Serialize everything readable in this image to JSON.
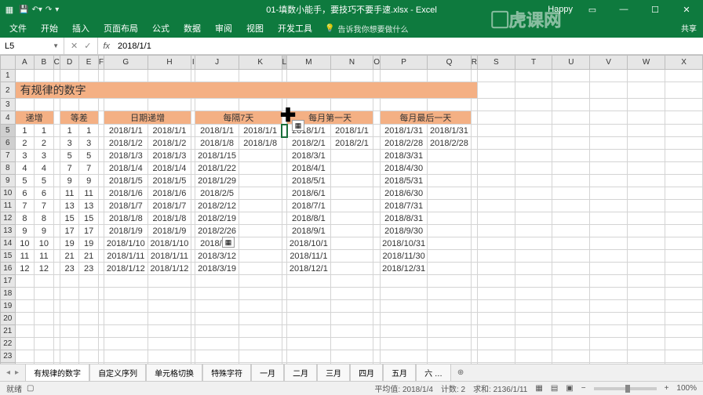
{
  "title": "01-填数小能手，要技巧不要手速.xlsx - Excel",
  "user": "Happy",
  "qat": [
    "save",
    "undo",
    "redo"
  ],
  "ribbon": [
    "文件",
    "开始",
    "插入",
    "页面布局",
    "公式",
    "数据",
    "审阅",
    "视图",
    "开发工具"
  ],
  "tell_me": "告诉我你想要做什么",
  "name_box": "L5",
  "formula": "2018/1/1",
  "columns": [
    "A",
    "B",
    "C",
    "D",
    "E",
    "F",
    "G",
    "H",
    "I",
    "J",
    "K",
    "L",
    "M",
    "N",
    "O",
    "P",
    "Q",
    "R",
    "S",
    "T",
    "U",
    "V",
    "W",
    "X"
  ],
  "big_title": "有规律的数字",
  "section_headers": {
    "incr": "递增",
    "diff": "等差",
    "date_incr": "日期递增",
    "every7": "每隔7天",
    "month_first": "每月第一天",
    "month_last": "每月最后一天"
  },
  "col_widths": [
    "xs",
    "s",
    "s",
    "gap",
    "s",
    "s",
    "gap",
    "m",
    "m",
    "gap",
    "m",
    "m",
    "gap",
    "m",
    "m",
    "gap",
    "m",
    "m",
    "gap",
    "m",
    "m",
    "m",
    "m",
    "m",
    "m"
  ],
  "data_rows": [
    [
      1,
      1,
      1,
      1,
      "2018/1/1",
      "2018/1/1",
      "2018/1/1",
      "2018/1/1",
      "2018/1/1",
      "2018/1/1",
      "2018/1/31",
      "2018/1/31"
    ],
    [
      2,
      2,
      3,
      3,
      "2018/1/2",
      "2018/1/2",
      "2018/1/8",
      "2018/1/8",
      "2018/2/1",
      "2018/2/1",
      "2018/2/28",
      "2018/2/28"
    ],
    [
      3,
      3,
      5,
      5,
      "2018/1/3",
      "2018/1/3",
      "2018/1/15",
      "",
      "2018/3/1",
      "",
      "2018/3/31",
      ""
    ],
    [
      4,
      4,
      7,
      7,
      "2018/1/4",
      "2018/1/4",
      "2018/1/22",
      "",
      "2018/4/1",
      "",
      "2018/4/30",
      ""
    ],
    [
      5,
      5,
      9,
      9,
      "2018/1/5",
      "2018/1/5",
      "2018/1/29",
      "",
      "2018/5/1",
      "",
      "2018/5/31",
      ""
    ],
    [
      6,
      6,
      11,
      11,
      "2018/1/6",
      "2018/1/6",
      "2018/2/5",
      "",
      "2018/6/1",
      "",
      "2018/6/30",
      ""
    ],
    [
      7,
      7,
      13,
      13,
      "2018/1/7",
      "2018/1/7",
      "2018/2/12",
      "",
      "2018/7/1",
      "",
      "2018/7/31",
      ""
    ],
    [
      8,
      8,
      15,
      15,
      "2018/1/8",
      "2018/1/8",
      "2018/2/19",
      "",
      "2018/8/1",
      "",
      "2018/8/31",
      ""
    ],
    [
      9,
      9,
      17,
      17,
      "2018/1/9",
      "2018/1/9",
      "2018/2/26",
      "",
      "2018/9/1",
      "",
      "2018/9/30",
      ""
    ],
    [
      10,
      10,
      19,
      19,
      "2018/1/10",
      "2018/1/10",
      "2018/3/5",
      "",
      "2018/10/1",
      "",
      "2018/10/31",
      ""
    ],
    [
      11,
      11,
      21,
      21,
      "2018/1/11",
      "2018/1/11",
      "2018/3/12",
      "",
      "2018/11/1",
      "",
      "2018/11/30",
      ""
    ],
    [
      12,
      12,
      23,
      23,
      "2018/1/12",
      "2018/1/12",
      "2018/3/19",
      "",
      "2018/12/1",
      "",
      "2018/12/31",
      ""
    ]
  ],
  "sheets": [
    "有规律的数字",
    "自定义序列",
    "单元格切换",
    "特殊字符",
    "一月",
    "二月",
    "三月",
    "四月",
    "五月",
    "六 …"
  ],
  "active_sheet": 0,
  "status": {
    "mode": "就绪",
    "rec": "",
    "avg_lbl": "平均值:",
    "avg": "2018/1/4",
    "cnt_lbl": "计数:",
    "cnt": "2",
    "sum_lbl": "求和:",
    "sum": "2136/1/11",
    "zoom": "100%"
  },
  "watermark_text": "虎课网"
}
